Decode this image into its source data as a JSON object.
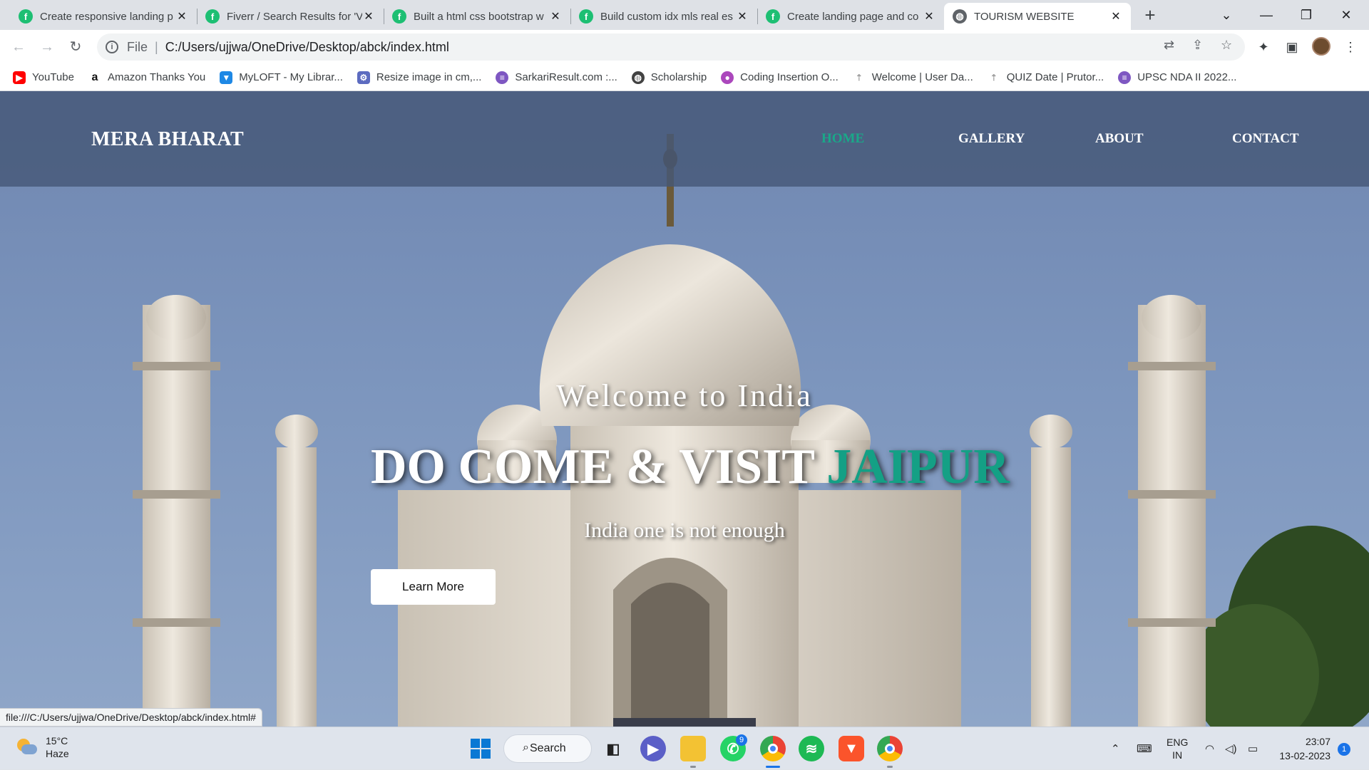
{
  "browser": {
    "tabs": [
      {
        "title": "Create responsive landing p",
        "favicon": "fiverr-icon"
      },
      {
        "title": "Fiverr / Search Results for 'V",
        "favicon": "fiverr-icon"
      },
      {
        "title": "Built a html css bootstrap w",
        "favicon": "fiverr-icon"
      },
      {
        "title": "Build custom idx mls real es",
        "favicon": "fiverr-icon"
      },
      {
        "title": "Create landing page and co",
        "favicon": "fiverr-icon"
      },
      {
        "title": "TOURISM WEBSITE",
        "favicon": "globe-icon",
        "active": true
      }
    ],
    "address": {
      "scheme": "File",
      "url": "C:/Users/ujjwa/OneDrive/Desktop/abck/index.html"
    },
    "bookmarks": [
      {
        "label": "YouTube",
        "icon": "youtube-icon",
        "color": "#ff0000"
      },
      {
        "label": "Amazon Thanks You",
        "icon": "amazon-icon",
        "color": "#222222"
      },
      {
        "label": "MyLOFT - My Librar...",
        "icon": "myloft-icon",
        "color": "#1e88e5"
      },
      {
        "label": "Resize image in cm,...",
        "icon": "gear-icon",
        "color": "#5c6bc0"
      },
      {
        "label": "SarkariResult.com :...",
        "icon": "globe-icon",
        "color": "#7e57c2"
      },
      {
        "label": "Scholarship",
        "icon": "globe-icon",
        "color": "#424242"
      },
      {
        "label": "Coding Insertion O...",
        "icon": "avatar-icon",
        "color": "#ab47bc"
      },
      {
        "label": "Welcome | User Da...",
        "icon": "upload-icon",
        "color": "#9e9e9e"
      },
      {
        "label": "QUIZ Date | Prutor...",
        "icon": "upload-icon",
        "color": "#9e9e9e"
      },
      {
        "label": "UPSC NDA II 2022...",
        "icon": "globe-icon",
        "color": "#7e57c2"
      }
    ],
    "status_url": "file:///C:/Users/ujjwa/OneDrive/Desktop/abck/index.html#"
  },
  "site": {
    "brand": "MERA BHARAT",
    "nav": [
      {
        "label": "HOME",
        "active": true
      },
      {
        "label": "GALLERY"
      },
      {
        "label": "ABOUT"
      },
      {
        "label": "CONTACT"
      }
    ],
    "hero": {
      "welcome": "Welcome to India",
      "headline_prefix": "DO COME & VISIT ",
      "headline_highlight": "JAIPUR",
      "tagline": "India one is not enough",
      "cta": "Learn More"
    },
    "colors": {
      "accent": "#14a085",
      "navbar": "#465878"
    }
  },
  "taskbar": {
    "weather": {
      "temp": "15°C",
      "condition": "Haze"
    },
    "search_label": "Search",
    "apps": [
      {
        "name": "windows-start-icon"
      },
      {
        "name": "file-viewer-icon"
      },
      {
        "name": "teams-chat-icon"
      },
      {
        "name": "file-explorer-icon"
      },
      {
        "name": "whatsapp-icon",
        "badge": "9"
      },
      {
        "name": "chrome-icon"
      },
      {
        "name": "spotify-icon"
      },
      {
        "name": "brave-icon"
      },
      {
        "name": "chrome-profile-icon"
      }
    ],
    "language": {
      "line1": "ENG",
      "line2": "IN"
    },
    "clock": {
      "time": "23:07",
      "date": "13-02-2023"
    },
    "notification_count": "1"
  }
}
